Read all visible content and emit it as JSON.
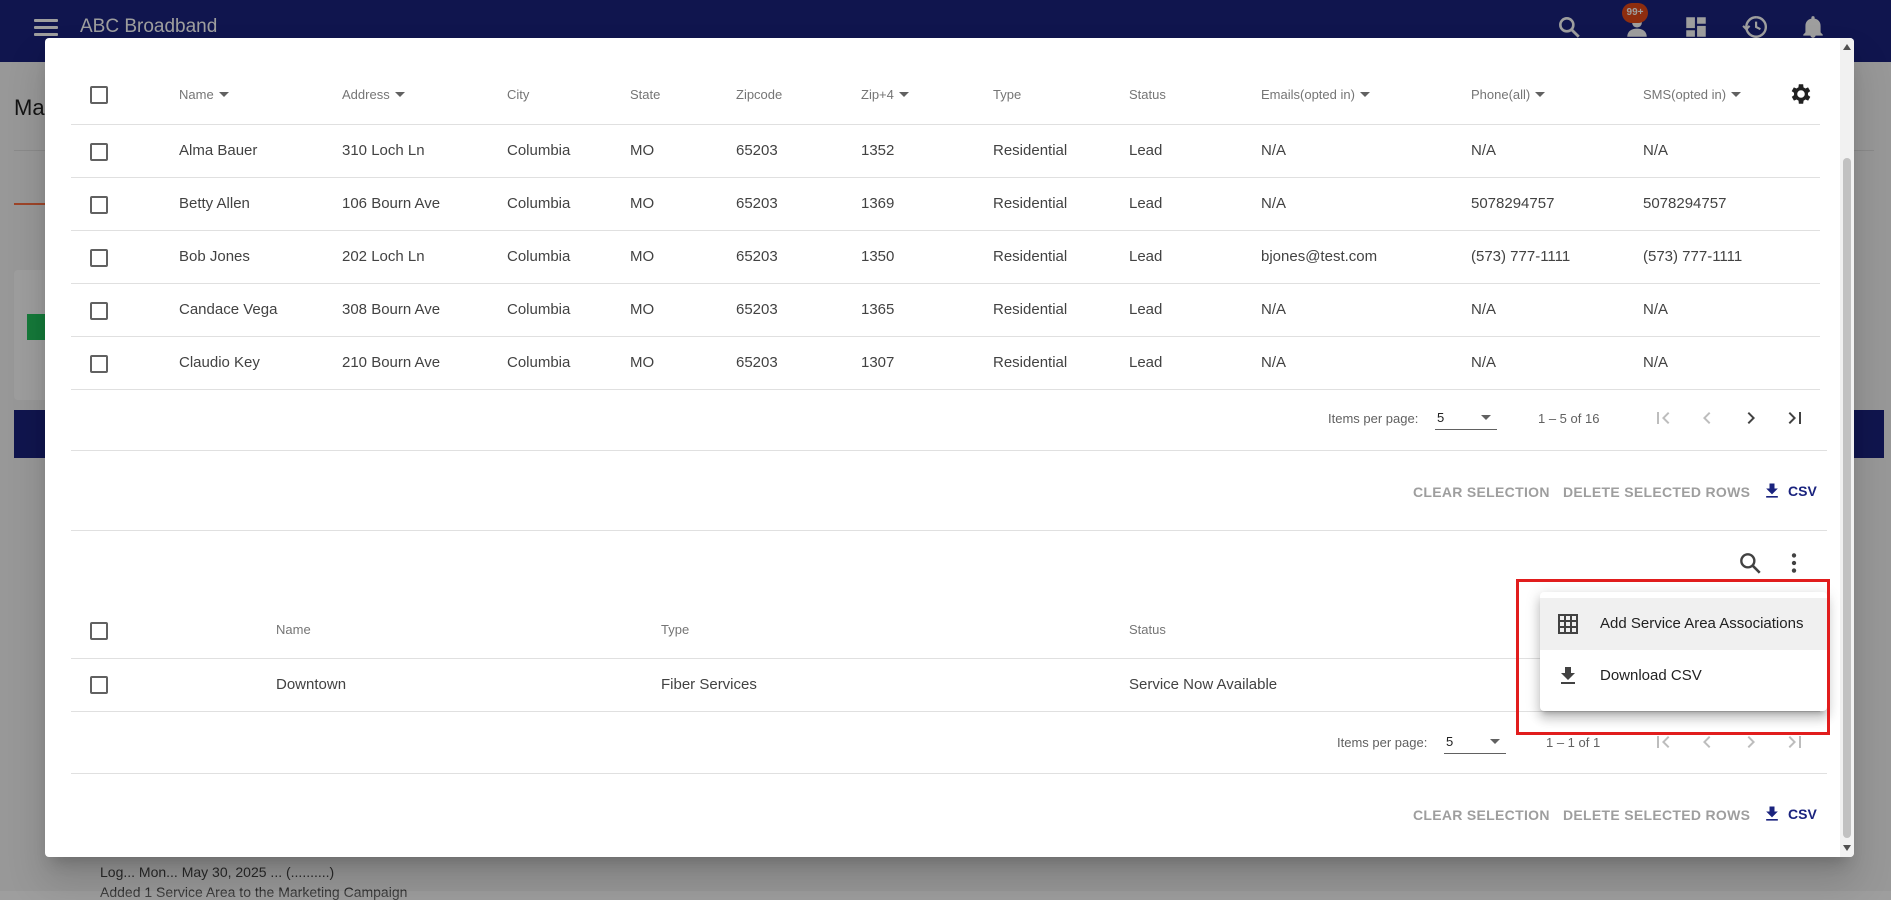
{
  "app": {
    "title": "ABC Broadband",
    "notification_badge": "99+",
    "page_heading_partial": "Ma",
    "bottom_text_1": "Log... Mon... May 30, 2025 ... (..........)",
    "bottom_text_2": "Added 1 Service Area to the Marketing Campaign"
  },
  "colors": {
    "primary": "#1a237e",
    "accent": "#ff7043",
    "badge": "#e64a19",
    "highlight": "#e11d1d"
  },
  "contacts_table": {
    "headers": {
      "name": "Name",
      "address": "Address",
      "city": "City",
      "state": "State",
      "zipcode": "Zipcode",
      "zip4": "Zip+4",
      "type": "Type",
      "status": "Status",
      "emails": "Emails(opted in)",
      "phone": "Phone(all)",
      "sms": "SMS(opted in)"
    },
    "rows": [
      {
        "name": "Alma Bauer",
        "address": "310 Loch Ln",
        "city": "Columbia",
        "state": "MO",
        "zipcode": "65203",
        "zip4": "1352",
        "type": "Residential",
        "status": "Lead",
        "emails": "N/A",
        "phone": "N/A",
        "sms": "N/A"
      },
      {
        "name": "Betty Allen",
        "address": "106 Bourn Ave",
        "city": "Columbia",
        "state": "MO",
        "zipcode": "65203",
        "zip4": "1369",
        "type": "Residential",
        "status": "Lead",
        "emails": "N/A",
        "phone": "5078294757",
        "sms": "5078294757"
      },
      {
        "name": "Bob Jones",
        "address": "202 Loch Ln",
        "city": "Columbia",
        "state": "MO",
        "zipcode": "65203",
        "zip4": "1350",
        "type": "Residential",
        "status": "Lead",
        "emails": "bjones@test.com",
        "phone": "(573) 777-1111",
        "sms": "(573) 777-1111"
      },
      {
        "name": "Candace Vega",
        "address": "308 Bourn Ave",
        "city": "Columbia",
        "state": "MO",
        "zipcode": "65203",
        "zip4": "1365",
        "type": "Residential",
        "status": "Lead",
        "emails": "N/A",
        "phone": "N/A",
        "sms": "N/A"
      },
      {
        "name": "Claudio Key",
        "address": "210 Bourn Ave",
        "city": "Columbia",
        "state": "MO",
        "zipcode": "65203",
        "zip4": "1307",
        "type": "Residential",
        "status": "Lead",
        "emails": "N/A",
        "phone": "N/A",
        "sms": "N/A"
      }
    ],
    "paginator": {
      "items_per_page_label": "Items per page:",
      "items_per_page_value": "5",
      "range_label": "1 – 5 of 16"
    },
    "actions": {
      "clear_selection": "CLEAR SELECTION",
      "delete_selected": "DELETE SELECTED ROWS",
      "csv": "CSV"
    }
  },
  "service_area_table": {
    "headers": {
      "name": "Name",
      "type": "Type",
      "status": "Status"
    },
    "rows": [
      {
        "name": "Downtown",
        "type": "Fiber Services",
        "status": "Service Now Available"
      }
    ],
    "paginator": {
      "items_per_page_label": "Items per page:",
      "items_per_page_value": "5",
      "range_label": "1 – 1 of 1"
    },
    "actions": {
      "clear_selection": "CLEAR SELECTION",
      "delete_selected": "DELETE SELECTED ROWS",
      "csv": "CSV"
    }
  },
  "context_menu": {
    "items": [
      {
        "label": "Add Service Area Associations",
        "icon": "grid-icon"
      },
      {
        "label": "Download CSV",
        "icon": "download-icon"
      }
    ]
  }
}
